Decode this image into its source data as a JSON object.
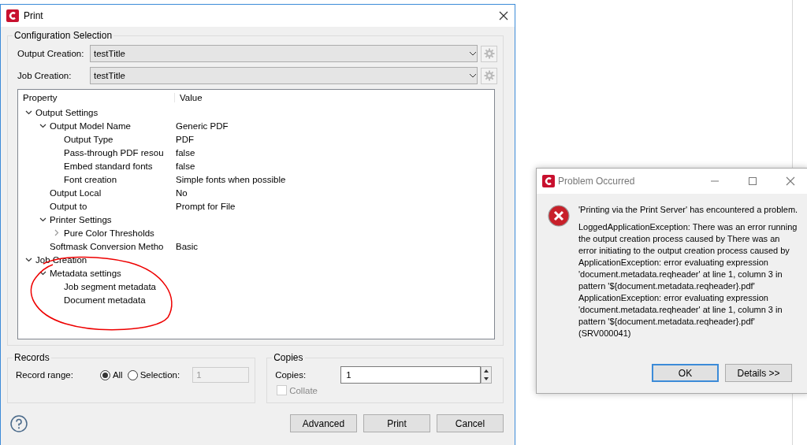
{
  "print_window": {
    "title": "Print",
    "configuration": {
      "title": "Configuration Selection",
      "fields": [
        {
          "label": "Output Creation:",
          "value": "testTitle"
        },
        {
          "label": "Job Creation:",
          "value": "testTitle"
        }
      ]
    },
    "property_table": {
      "columns": [
        "Property",
        "Value"
      ],
      "rows": [
        {
          "label": "Output Settings",
          "expanded": true,
          "children": [
            {
              "label": "Output Model Name",
              "value": "Generic PDF",
              "expanded": true,
              "children": [
                {
                  "label": "Output Type",
                  "value": "PDF"
                },
                {
                  "label": "Pass-through PDF resou",
                  "value": "false"
                },
                {
                  "label": "Embed standard fonts",
                  "value": "false"
                },
                {
                  "label": "Font creation",
                  "value": "Simple fonts when possible"
                }
              ]
            },
            {
              "label": "Output Local",
              "value": "No"
            },
            {
              "label": "Output to",
              "value": "Prompt for File"
            },
            {
              "label": "Printer Settings",
              "expanded": true,
              "children": [
                {
                  "label": "Pure Color Thresholds",
                  "expanded": false
                }
              ]
            },
            {
              "label": "Softmask Conversion Metho",
              "value": "Basic"
            }
          ]
        },
        {
          "label": "Job Creation",
          "expanded": true,
          "children": [
            {
              "label": "Metadata settings",
              "expanded": true,
              "children": [
                {
                  "label": "Job segment metadata"
                },
                {
                  "label": "Document metadata"
                }
              ]
            }
          ]
        }
      ]
    },
    "records": {
      "title": "Records",
      "label": "Record range:",
      "options": [
        {
          "label": "All",
          "selected": true
        },
        {
          "label": "Selection:",
          "selected": false
        }
      ],
      "selection_value": "1",
      "selection_disabled": true
    },
    "copies": {
      "title": "Copies",
      "label": "Copies:",
      "value": "1",
      "collate": {
        "label": "Collate",
        "checked": false,
        "disabled": true
      }
    },
    "buttons": [
      "Advanced",
      "Print",
      "Cancel"
    ]
  },
  "error_dialog": {
    "title": "Problem Occurred",
    "headline": "'Printing via the Print Server' has encountered a problem.",
    "message": "LoggedApplicationException: There was an error running\nthe output creation process caused by There was an\nerror initiating to the output creation process caused by\nApplicationException: error evaluating expression\n'document.metadata.reqheader' at line 1, column 3 in\npattern '${document.metadata.reqheader}.pdf'\nApplicationException: error evaluating expression\n'document.metadata.reqheader' at line 1, column 3 in\npattern '${document.metadata.reqheader}.pdf'\n (SRV000041)",
    "buttons": [
      {
        "label": "OK",
        "default": true
      },
      {
        "label": "Details >>",
        "default": false
      }
    ]
  }
}
